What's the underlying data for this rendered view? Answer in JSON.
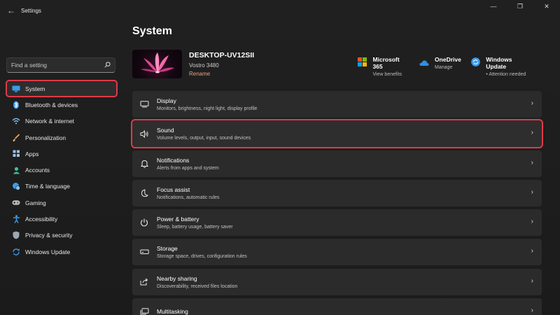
{
  "window": {
    "title": "Settings"
  },
  "titlebar": {
    "back": "←",
    "minimize": "—",
    "maximize": "❐",
    "close": "✕"
  },
  "sidebar": {
    "search_placeholder": "Find a setting",
    "items": [
      {
        "label": "System",
        "icon": "monitor-icon",
        "color": "#3d9be9",
        "active": true
      },
      {
        "label": "Bluetooth & devices",
        "icon": "bluetooth-icon",
        "color": "#3d9be9"
      },
      {
        "label": "Network & internet",
        "icon": "wifi-icon",
        "color": "#7fc4f2"
      },
      {
        "label": "Personalization",
        "icon": "brush-icon",
        "color": "#f2a35a"
      },
      {
        "label": "Apps",
        "icon": "apps-icon",
        "color": "#9ec3e6"
      },
      {
        "label": "Accounts",
        "icon": "person-icon",
        "color": "#3fbfa0"
      },
      {
        "label": "Time & language",
        "icon": "globe-clock-icon",
        "color": "#3d9be9"
      },
      {
        "label": "Gaming",
        "icon": "gamepad-icon",
        "color": "#b9b9b9"
      },
      {
        "label": "Accessibility",
        "icon": "accessibility-icon",
        "color": "#3d9be9"
      },
      {
        "label": "Privacy & security",
        "icon": "shield-icon",
        "color": "#9ea7b3"
      },
      {
        "label": "Windows Update",
        "icon": "update-icon",
        "color": "#3d9be9"
      }
    ]
  },
  "main": {
    "title": "System",
    "device": {
      "name": "DESKTOP-UV12SII",
      "model": "Vostro 3480",
      "rename": "Rename"
    },
    "quick_links": [
      {
        "title": "Microsoft 365",
        "sub": "View benefits",
        "icon": "office-icon"
      },
      {
        "title": "OneDrive",
        "sub": "Manage",
        "icon": "onedrive-icon"
      },
      {
        "title": "Windows Update",
        "sub": "Attention needed",
        "icon": "windows-update-icon"
      }
    ],
    "cards": [
      {
        "title": "Display",
        "sub": "Monitors, brightness, night light, display profile",
        "icon": "display-icon"
      },
      {
        "title": "Sound",
        "sub": "Volume levels, output, input, sound devices",
        "icon": "speaker-icon",
        "highlight": true
      },
      {
        "title": "Notifications",
        "sub": "Alerts from apps and system",
        "icon": "bell-icon"
      },
      {
        "title": "Focus assist",
        "sub": "Notifications, automatic rules",
        "icon": "moon-icon"
      },
      {
        "title": "Power & battery",
        "sub": "Sleep, battery usage, battery saver",
        "icon": "power-icon"
      },
      {
        "title": "Storage",
        "sub": "Storage space, drives, configuration rules",
        "icon": "storage-icon"
      },
      {
        "title": "Nearby sharing",
        "sub": "Discoverability, received files location",
        "icon": "share-icon"
      },
      {
        "title": "Multitasking",
        "sub": "",
        "icon": "multitask-icon"
      }
    ]
  }
}
